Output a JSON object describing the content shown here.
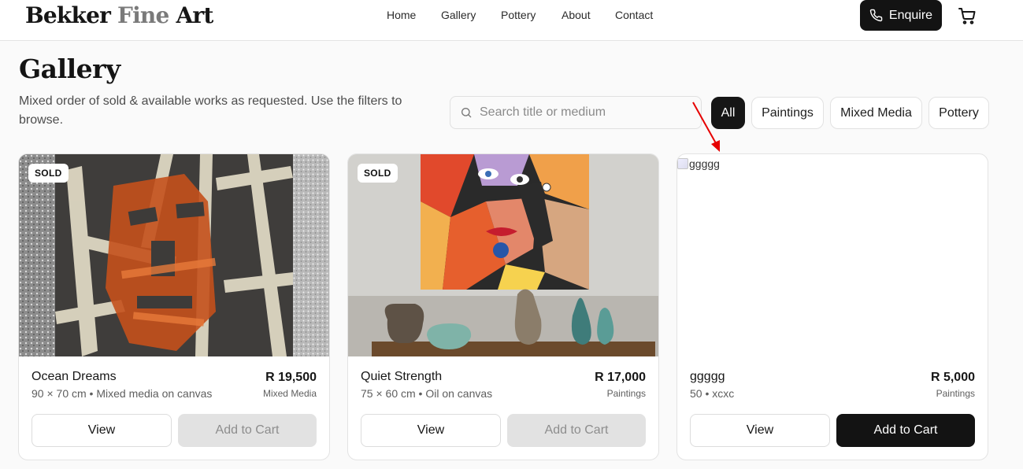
{
  "header": {
    "logo_part1": "Bekker ",
    "logo_part2": "Fine",
    "logo_part3": " Art",
    "nav": [
      "Home",
      "Gallery",
      "Pottery",
      "About",
      "Contact"
    ],
    "enquire_label": "Enquire",
    "icons": {
      "enquire": "phone-icon",
      "cart": "cart-icon"
    }
  },
  "hero": {
    "title": "Gallery",
    "subtitle": "Mixed order of sold & available works as requested. Use the filters to browse."
  },
  "search": {
    "placeholder": "Search title or medium",
    "value": "",
    "icon": "search-icon"
  },
  "filters": [
    {
      "label": "All",
      "active": true
    },
    {
      "label": "Paintings",
      "active": false
    },
    {
      "label": "Mixed Media",
      "active": false
    },
    {
      "label": "Pottery",
      "active": false
    }
  ],
  "annotation": {
    "color": "#e60000"
  },
  "cards": [
    {
      "title": "Ocean Dreams",
      "meta": "90 × 70 cm • Mixed media on canvas",
      "price": "R 19,500",
      "category": "Mixed Media",
      "badge": "SOLD",
      "view_label": "View",
      "cart_label": "Add to Cart",
      "cart_enabled": false
    },
    {
      "title": "Quiet Strength",
      "meta": "75 × 60 cm • Oil on canvas",
      "price": "R 17,000",
      "category": "Paintings",
      "badge": "SOLD",
      "view_label": "View",
      "cart_label": "Add to Cart",
      "cart_enabled": false
    },
    {
      "title": "ggggg",
      "meta": "50 • xcxc",
      "price": "R 5,000",
      "category": "Paintings",
      "image_alt": "ggggg",
      "view_label": "View",
      "cart_label": "Add to Cart",
      "cart_enabled": true
    }
  ]
}
